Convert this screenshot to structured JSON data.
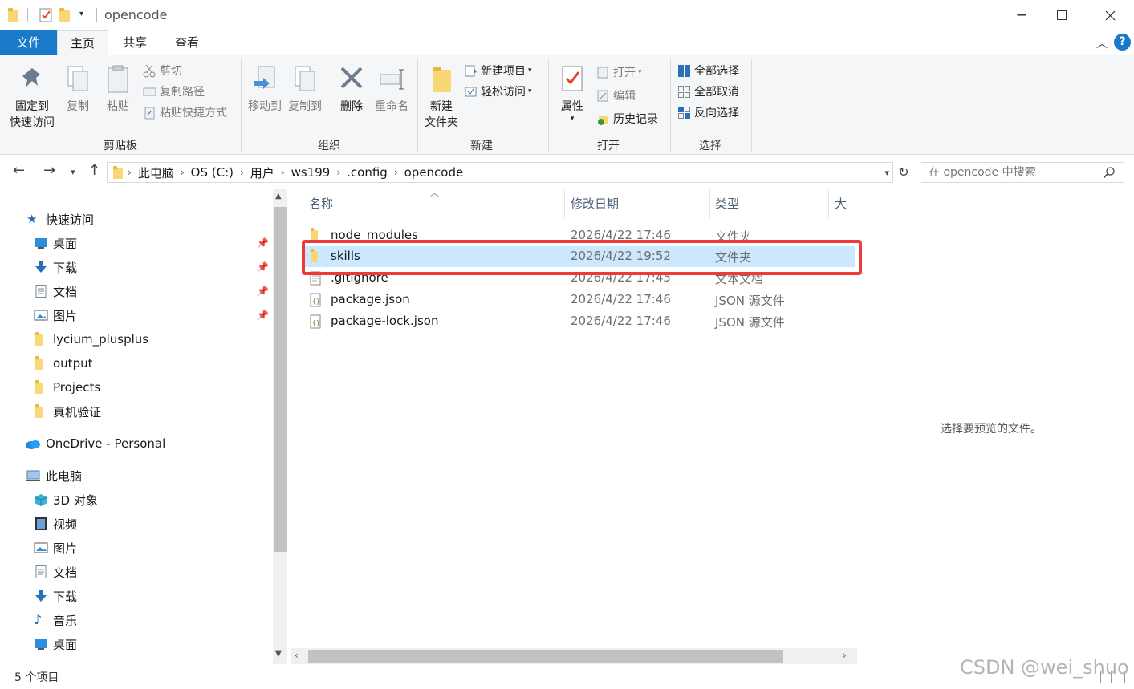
{
  "window": {
    "title": "opencode",
    "quick_access_toolbar": [
      "folder-icon",
      "properties-check-icon",
      "new-folder-icon",
      "customize-dropdown-icon"
    ],
    "controls": [
      "minimize",
      "maximize",
      "close"
    ]
  },
  "ribbon_tabs": [
    {
      "label": "文件",
      "active": false,
      "style": "file"
    },
    {
      "label": "主页",
      "active": true
    },
    {
      "label": "共享",
      "active": false
    },
    {
      "label": "查看",
      "active": false
    }
  ],
  "ribbon": {
    "clipboard": {
      "label": "剪贴板",
      "pin_label_1": "固定到",
      "pin_label_2": "快速访问",
      "copy": "复制",
      "paste": "粘贴",
      "cut": "剪切",
      "copy_path": "复制路径",
      "paste_shortcut": "粘贴快捷方式"
    },
    "organize": {
      "label": "组织",
      "move_to": "移动到",
      "copy_to": "复制到",
      "delete": "删除",
      "rename": "重命名"
    },
    "new": {
      "label": "新建",
      "new_folder_1": "新建",
      "new_folder_2": "文件夹",
      "new_item": "新建项目",
      "easy_access": "轻松访问"
    },
    "open": {
      "label": "打开",
      "properties": "属性",
      "open": "打开",
      "edit": "编辑",
      "history": "历史记录"
    },
    "select": {
      "label": "选择",
      "select_all": "全部选择",
      "select_none": "全部取消",
      "invert": "反向选择"
    }
  },
  "address": {
    "breadcrumbs": [
      "此电脑",
      "OS (C:)",
      "用户",
      "ws199",
      ".config",
      "opencode"
    ],
    "search_placeholder": "在 opencode 中搜索"
  },
  "nav_pane": {
    "quick_access": "快速访问",
    "quick_items": [
      {
        "label": "桌面",
        "icon": "desktop-icon",
        "pinned": true
      },
      {
        "label": "下载",
        "icon": "download-icon",
        "pinned": true
      },
      {
        "label": "文档",
        "icon": "document-icon",
        "pinned": true
      },
      {
        "label": "图片",
        "icon": "pictures-icon",
        "pinned": true
      },
      {
        "label": "lycium_plusplus",
        "icon": "folder-icon",
        "pinned": false
      },
      {
        "label": "output",
        "icon": "folder-icon",
        "pinned": false
      },
      {
        "label": "Projects",
        "icon": "folder-icon",
        "pinned": false
      },
      {
        "label": "真机验证",
        "icon": "folder-icon",
        "pinned": false
      }
    ],
    "onedrive": "OneDrive - Personal",
    "this_pc": "此电脑",
    "pc_items": [
      {
        "label": "3D 对象",
        "icon": "3d-objects-icon"
      },
      {
        "label": "视频",
        "icon": "video-icon"
      },
      {
        "label": "图片",
        "icon": "pictures-icon"
      },
      {
        "label": "文档",
        "icon": "document-icon"
      },
      {
        "label": "下载",
        "icon": "download-icon"
      },
      {
        "label": "音乐",
        "icon": "music-icon"
      },
      {
        "label": "桌面",
        "icon": "desktop-icon"
      }
    ]
  },
  "file_list": {
    "columns": [
      "名称",
      "修改日期",
      "类型",
      "大小"
    ],
    "rows": [
      {
        "name": "node_modules",
        "date": "2026/4/22 17:46",
        "type": "文件夹",
        "icon": "folder-icon",
        "selected": false
      },
      {
        "name": "skills",
        "date": "2026/4/22 19:52",
        "type": "文件夹",
        "icon": "folder-icon",
        "selected": true
      },
      {
        "name": ".gitignore",
        "date": "2026/4/22 17:45",
        "type": "文本文档",
        "icon": "text-file-icon",
        "selected": false
      },
      {
        "name": "package.json",
        "date": "2026/4/22 17:46",
        "type": "JSON 源文件",
        "icon": "json-file-icon",
        "selected": false
      },
      {
        "name": "package-lock.json",
        "date": "2026/4/22 17:46",
        "type": "JSON 源文件",
        "icon": "json-file-icon",
        "selected": false
      }
    ]
  },
  "preview_pane": {
    "message": "选择要预览的文件。"
  },
  "status_bar": {
    "item_count": "5 个项目"
  },
  "watermark": "CSDN @wei_shuo",
  "colors": {
    "accent": "#1979ca",
    "selection": "#cce8ff",
    "highlight_box": "#ef3a3a",
    "folder": "#f8d775"
  }
}
